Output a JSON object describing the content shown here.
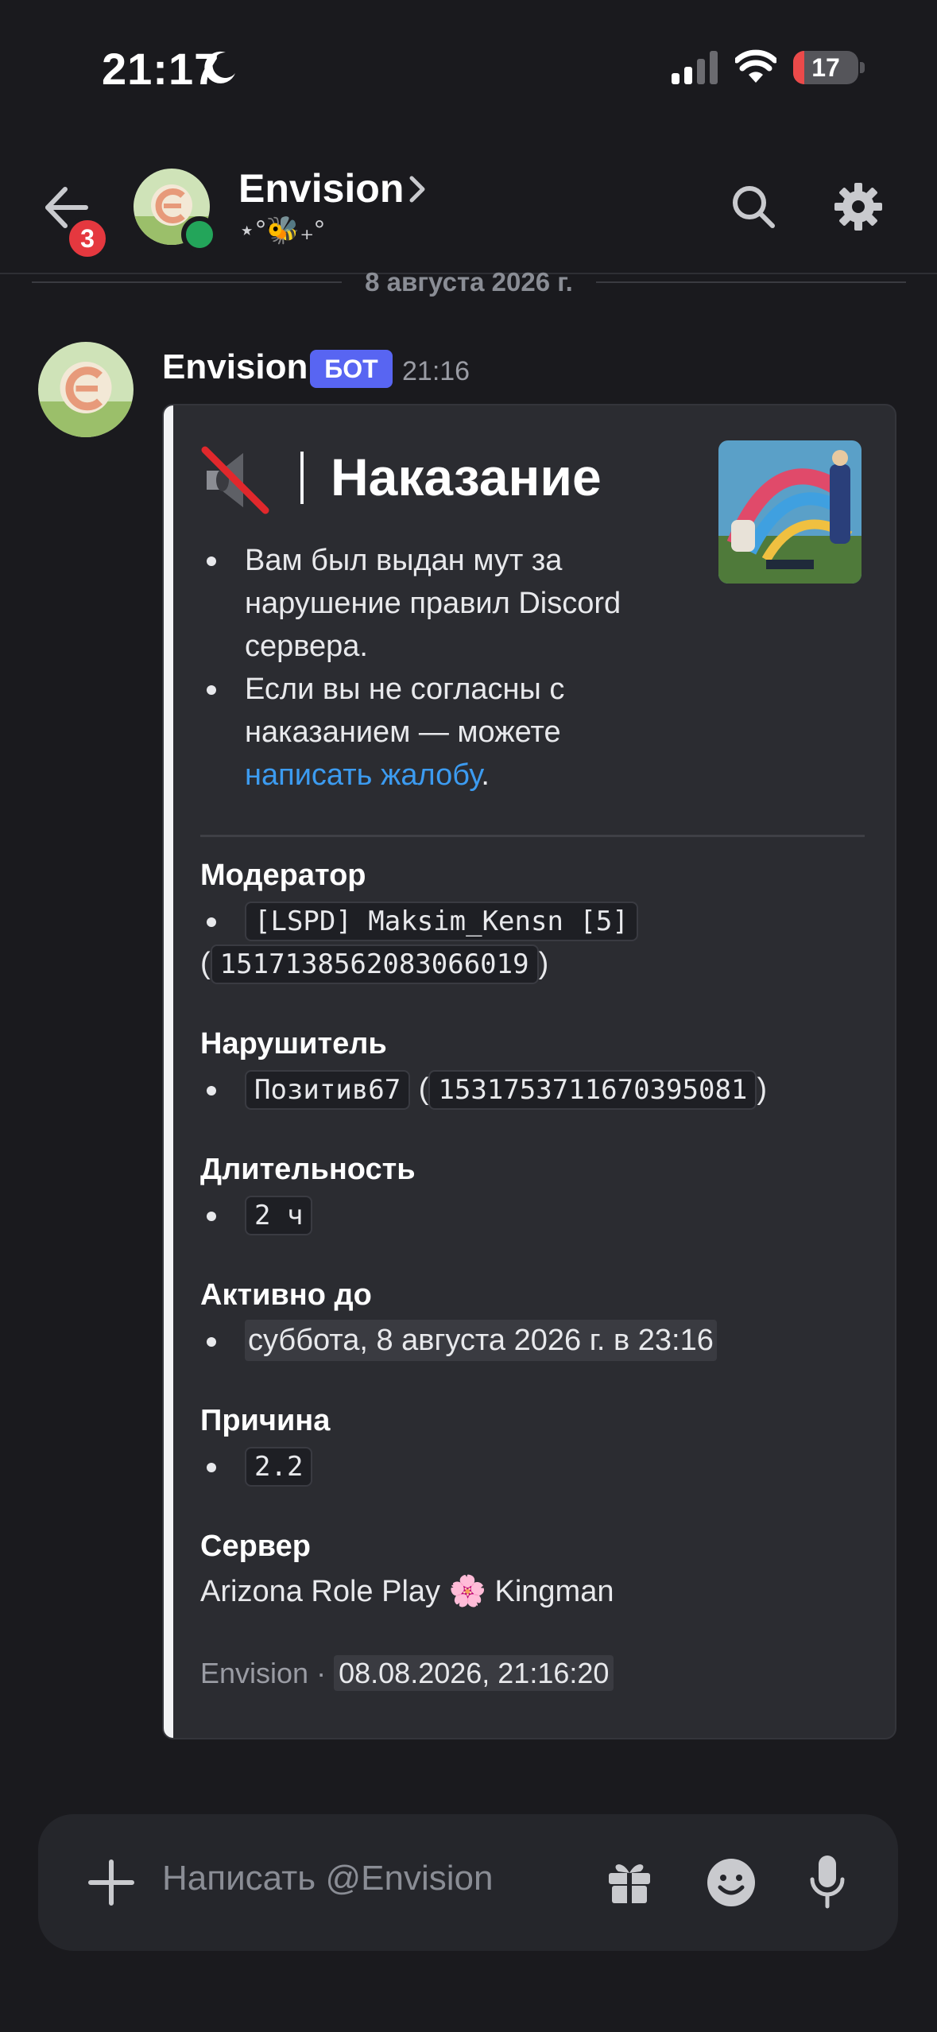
{
  "status_bar": {
    "time": "21:17",
    "battery": "17",
    "battery_level": 0.17
  },
  "header": {
    "back_badge": "3",
    "title": "Envision",
    "subtitle": "⋆°🐝₊°"
  },
  "date_separator": "8 августа 2026 г.",
  "message": {
    "author": "Envision",
    "bot_tag": "БОТ",
    "time": "21:16",
    "embed": {
      "title": "Наказание",
      "description": {
        "item1": "Вам был выдан мут за нарушение правил Discord сервера.",
        "item2_prefix": "Если вы не согласны с наказанием — можете ",
        "item2_link": "написать жалобу",
        "item2_suffix": "."
      },
      "moderator": {
        "title": "Модератор",
        "name": "[LSPD] Maksim_Kensn [5]",
        "open_paren": "(",
        "id": "1517138562083066019",
        "close_paren": ")"
      },
      "violator": {
        "title": "Нарушитель",
        "name": "Позитив67",
        "open_paren": "(",
        "id": "1531753711670395081",
        "close_paren": ")"
      },
      "duration": {
        "title": "Длительность",
        "value": "2 ч"
      },
      "active_until": {
        "title": "Активно до",
        "value": "суббота, 8 августа 2026 г. в 23:16"
      },
      "reason": {
        "title": "Причина",
        "value": "2.2"
      },
      "server": {
        "title": "Сервер",
        "prefix": "Arizona Role Play",
        "emoji": "🌸",
        "suffix": "Kingman"
      },
      "footer": {
        "author": "Envision",
        "dot": "·",
        "timestamp": "08.08.2026, 21:16:20"
      }
    }
  },
  "composer": {
    "placeholder": "Написать @Envision"
  },
  "colors": {
    "background": "#1a1a1e",
    "bot_tag": "#5865f2",
    "link": "#3c9bf0",
    "online": "#23a55a",
    "badge": "#e5383f"
  }
}
